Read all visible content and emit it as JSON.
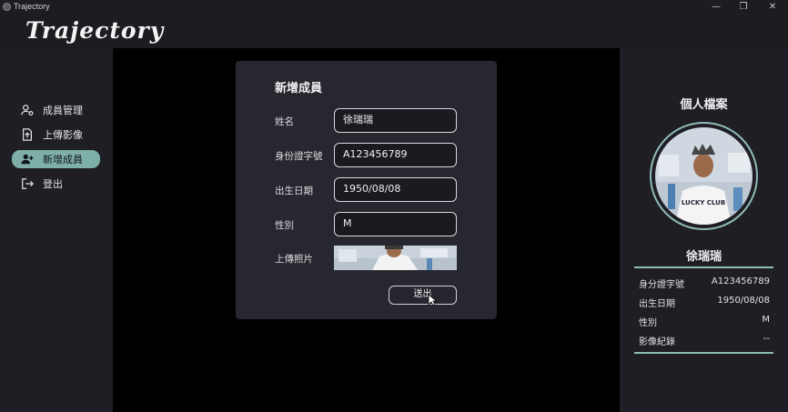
{
  "window": {
    "title": "Trajectory",
    "minimize": "—",
    "restore": "❐",
    "close": "✕"
  },
  "brand": {
    "logo": "Trajectory"
  },
  "sidebar": {
    "items": [
      {
        "label": "成員管理",
        "icon": "members-settings-icon"
      },
      {
        "label": "上傳影像",
        "icon": "upload-file-icon"
      },
      {
        "label": "新增成員",
        "icon": "add-person-icon",
        "active": true
      },
      {
        "label": "登出",
        "icon": "logout-icon"
      }
    ]
  },
  "dialog": {
    "title": "新增成員",
    "fields": [
      {
        "label": "姓名",
        "value": "徐瑞瑞"
      },
      {
        "label": "身份證字號",
        "value": "A123456789"
      },
      {
        "label": "出生日期",
        "value": "1950/08/08"
      },
      {
        "label": "性別",
        "value": "M"
      }
    ],
    "photo_label": "上傳照片",
    "submit_label": "送出"
  },
  "profile": {
    "title": "個人檔案",
    "name": "徐瑞瑞",
    "shirt_text": "LUCKY CLUB",
    "info": [
      {
        "label": "身分證字號",
        "value": "A123456789"
      },
      {
        "label": "出生日期",
        "value": "1950/08/08"
      },
      {
        "label": "性別",
        "value": "M"
      },
      {
        "label": "影像紀錄",
        "value": "--"
      }
    ]
  },
  "colors": {
    "accent": "#7fb0a8",
    "avatar_ring": "#8fbcb5",
    "background": "#1e1e24",
    "canvas": "#000000",
    "dialog": "#27272f"
  }
}
